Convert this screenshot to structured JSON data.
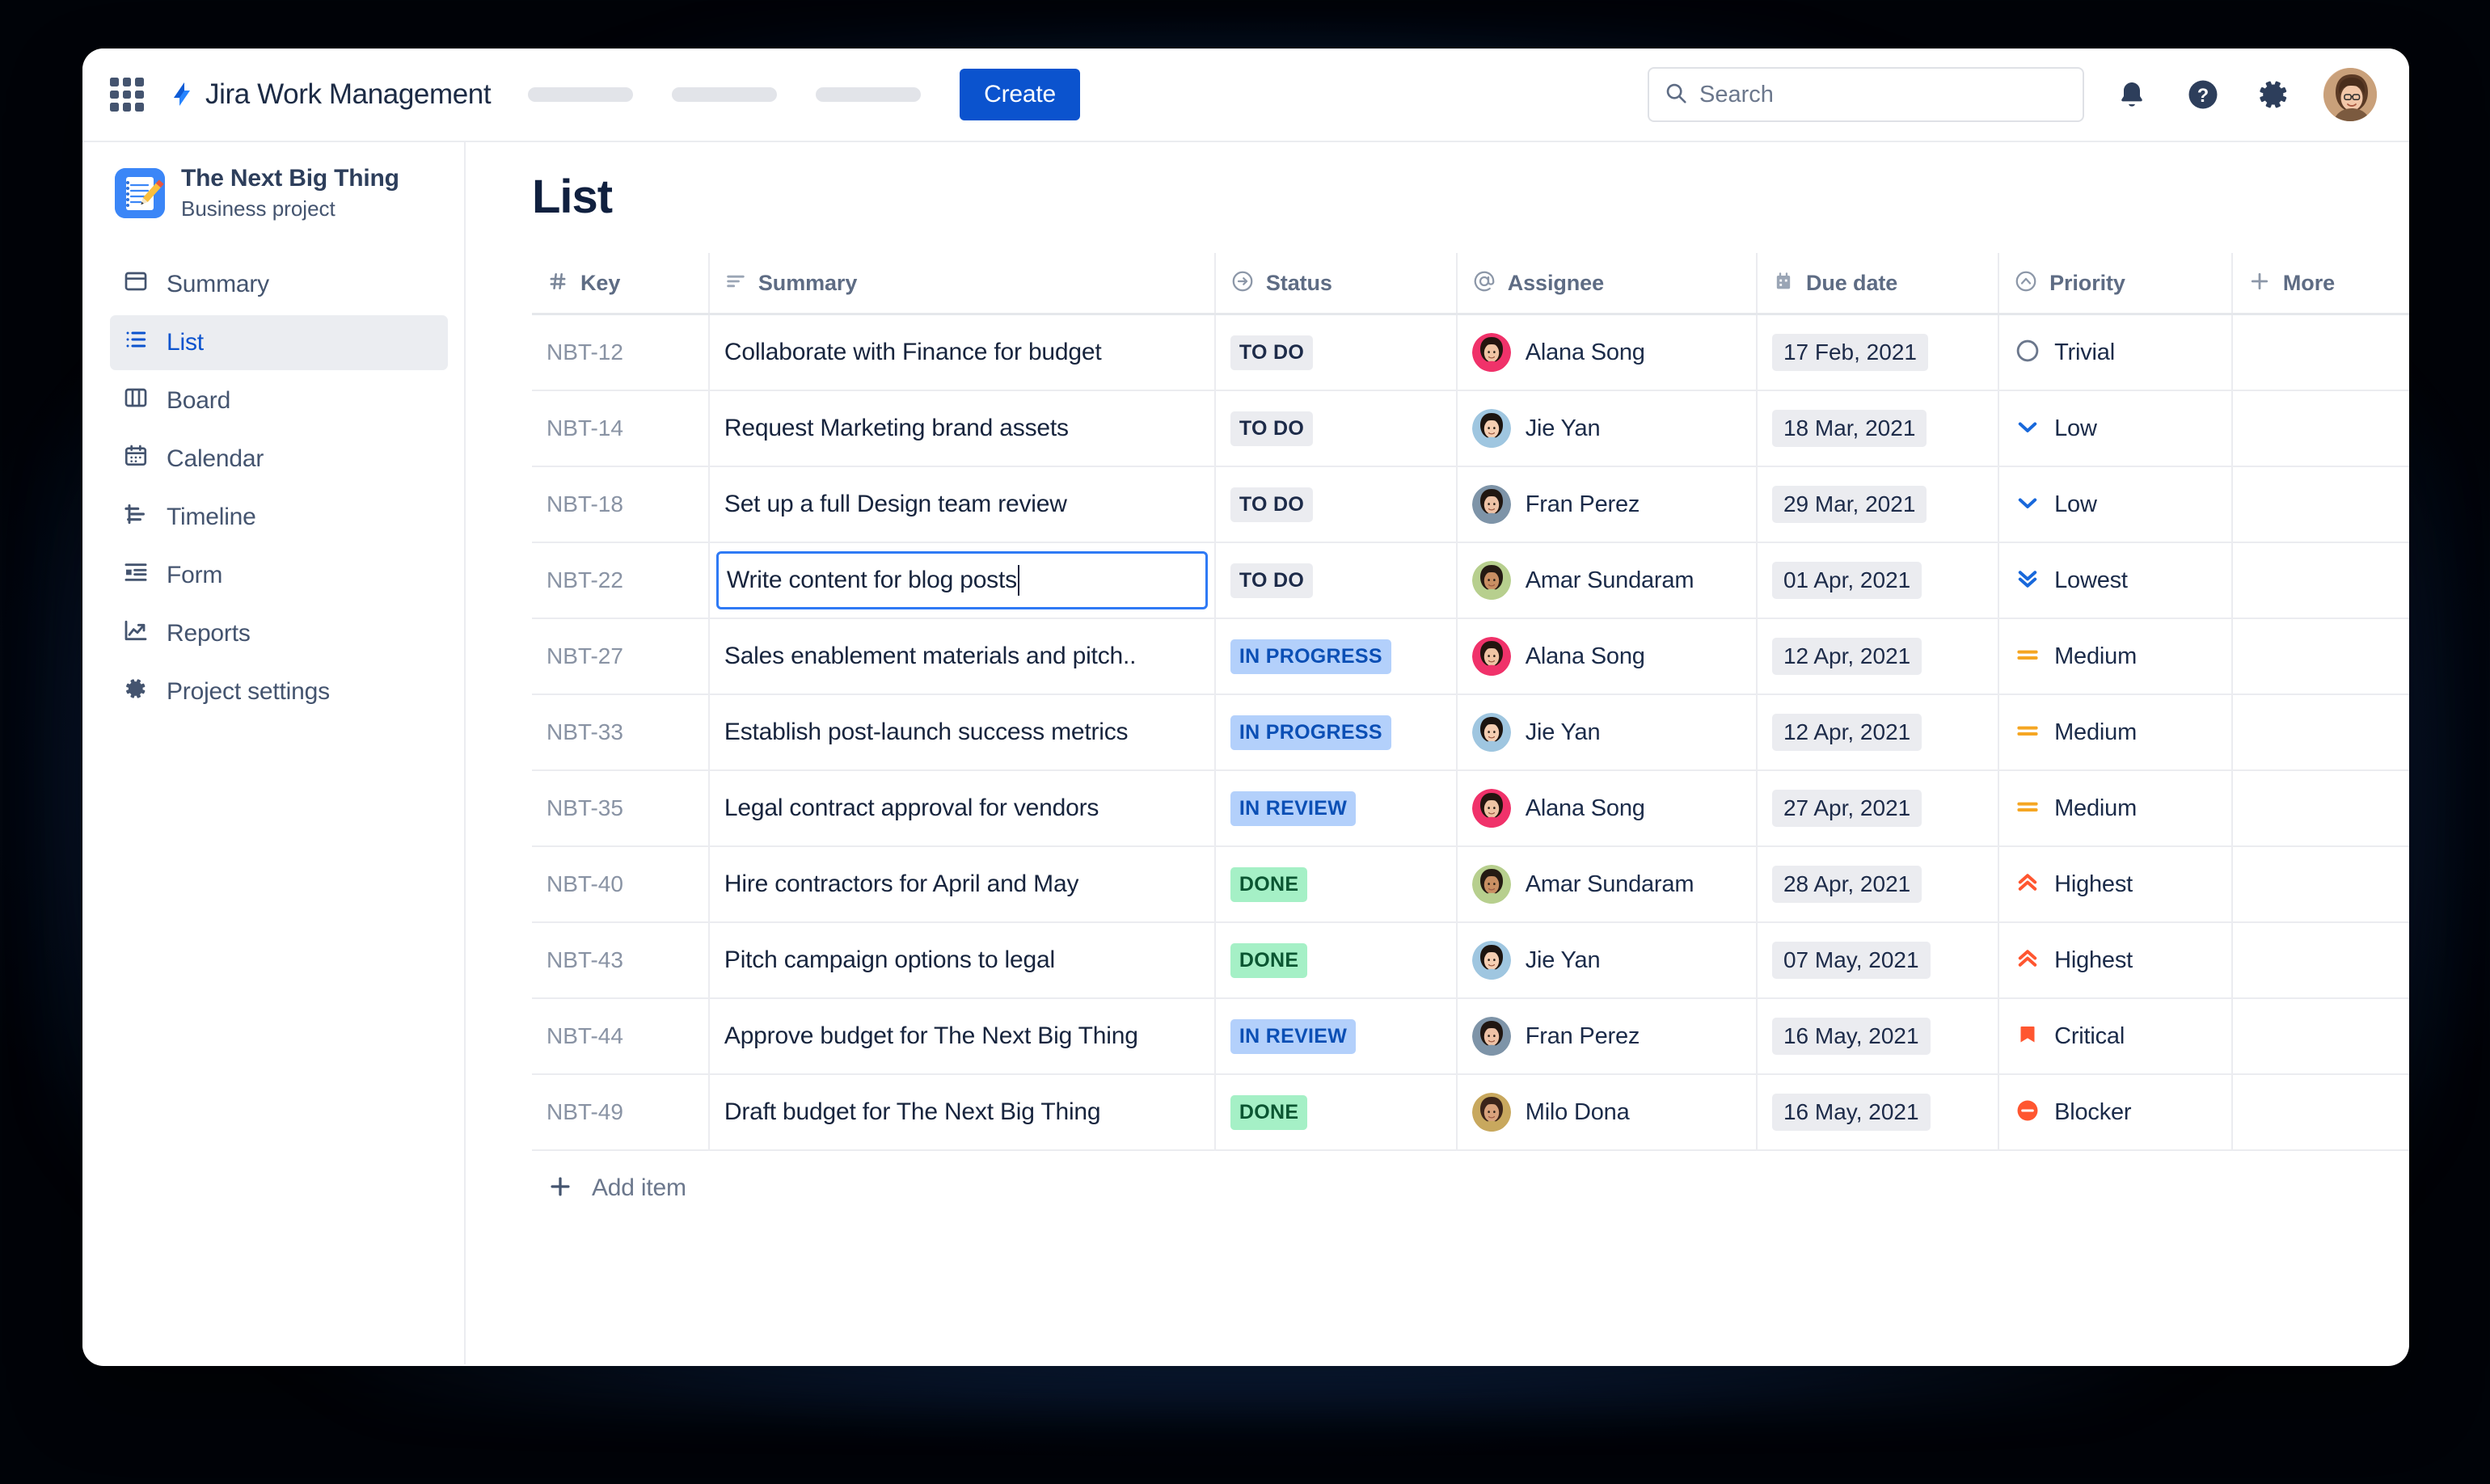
{
  "topbar": {
    "app_name": "Jira Work Management",
    "logo_icon": "jira-logo-icon",
    "app_switcher_icon": "apps-grid-icon",
    "nav_placeholders": [
      "",
      "",
      ""
    ],
    "create_label": "Create",
    "search": {
      "placeholder": "Search",
      "value": "",
      "icon": "search-icon"
    },
    "notifications_icon": "bell-icon",
    "help_icon": "question-circle-icon",
    "settings_icon": "gear-icon",
    "avatar_icon": "user-avatar"
  },
  "sidebar": {
    "project": {
      "name": "The Next Big Thing",
      "type": "Business project",
      "icon": "notepad-pencil-icon"
    },
    "items": [
      {
        "label": "Summary",
        "icon": "summary-window-icon",
        "active": false
      },
      {
        "label": "List",
        "icon": "list-icon",
        "active": true
      },
      {
        "label": "Board",
        "icon": "board-columns-icon",
        "active": false
      },
      {
        "label": "Calendar",
        "icon": "calendar-icon",
        "active": false
      },
      {
        "label": "Timeline",
        "icon": "timeline-icon",
        "active": false
      },
      {
        "label": "Form",
        "icon": "form-icon",
        "active": false
      },
      {
        "label": "Reports",
        "icon": "reports-chart-icon",
        "active": false
      },
      {
        "label": "Project settings",
        "icon": "gear-icon",
        "active": false
      }
    ]
  },
  "main": {
    "page_title": "List",
    "columns": [
      {
        "label": "Key",
        "icon": "hash-icon"
      },
      {
        "label": "Summary",
        "icon": "text-lines-icon"
      },
      {
        "label": "Status",
        "icon": "arrow-right-circle-icon"
      },
      {
        "label": "Assignee",
        "icon": "at-sign-icon"
      },
      {
        "label": "Due date",
        "icon": "calendar-icon"
      },
      {
        "label": "Priority",
        "icon": "chevron-up-circle-icon"
      },
      {
        "label": "More",
        "icon": "plus-icon"
      }
    ],
    "add_item_label": "Add item",
    "add_item_icon": "plus-icon",
    "editing_row_key": "NBT-22",
    "rows": [
      {
        "key": "NBT-12",
        "summary": "Collaborate with Finance for budget",
        "status": "TO DO",
        "status_kind": "todo",
        "assignee": "Alana Song",
        "avatar": "alana",
        "due": "17 Feb, 2021",
        "priority": "Trivial",
        "priority_icon": "circle-outline-icon",
        "editing": false
      },
      {
        "key": "NBT-14",
        "summary": "Request Marketing brand assets",
        "status": "TO DO",
        "status_kind": "todo",
        "assignee": "Jie Yan",
        "avatar": "jie",
        "due": "18 Mar, 2021",
        "priority": "Low",
        "priority_icon": "chevron-down-icon",
        "editing": false
      },
      {
        "key": "NBT-18",
        "summary": "Set up a full Design team review",
        "status": "TO DO",
        "status_kind": "todo",
        "assignee": "Fran Perez",
        "avatar": "fran",
        "due": "29 Mar, 2021",
        "priority": "Low",
        "priority_icon": "chevron-down-icon",
        "editing": false
      },
      {
        "key": "NBT-22",
        "summary": "Write content for blog posts",
        "status": "TO DO",
        "status_kind": "todo",
        "assignee": "Amar Sundaram",
        "avatar": "amar",
        "due": "01 Apr, 2021",
        "priority": "Lowest",
        "priority_icon": "double-chevron-down-icon",
        "editing": true
      },
      {
        "key": "NBT-27",
        "summary": "Sales enablement materials and pitch..",
        "status": "IN PROGRESS",
        "status_kind": "inprogress",
        "assignee": "Alana Song",
        "avatar": "alana",
        "due": "12 Apr, 2021",
        "priority": "Medium",
        "priority_icon": "equals-icon",
        "editing": false
      },
      {
        "key": "NBT-33",
        "summary": "Establish post-launch success metrics",
        "status": "IN PROGRESS",
        "status_kind": "inprogress",
        "assignee": "Jie Yan",
        "avatar": "jie",
        "due": "12 Apr, 2021",
        "priority": "Medium",
        "priority_icon": "equals-icon",
        "editing": false
      },
      {
        "key": "NBT-35",
        "summary": "Legal contract approval for vendors",
        "status": "IN REVIEW",
        "status_kind": "inreview",
        "assignee": "Alana Song",
        "avatar": "alana",
        "due": "27 Apr, 2021",
        "priority": "Medium",
        "priority_icon": "equals-icon",
        "editing": false
      },
      {
        "key": "NBT-40",
        "summary": "Hire contractors for April and May",
        "status": "DONE",
        "status_kind": "done",
        "assignee": "Amar Sundaram",
        "avatar": "amar",
        "due": "28 Apr, 2021",
        "priority": "Highest",
        "priority_icon": "double-chevron-up-icon",
        "editing": false
      },
      {
        "key": "NBT-43",
        "summary": "Pitch campaign options to legal",
        "status": "DONE",
        "status_kind": "done",
        "assignee": "Jie Yan",
        "avatar": "jie",
        "due": "07 May, 2021",
        "priority": "Highest",
        "priority_icon": "double-chevron-up-icon",
        "editing": false
      },
      {
        "key": "NBT-44",
        "summary": "Approve budget for The Next Big Thing",
        "status": "IN REVIEW",
        "status_kind": "inreview",
        "assignee": "Fran Perez",
        "avatar": "fran",
        "due": "16 May, 2021",
        "priority": "Critical",
        "priority_icon": "bookmark-filled-icon",
        "editing": false
      },
      {
        "key": "NBT-49",
        "summary": "Draft budget for The Next Big Thing",
        "status": "DONE",
        "status_kind": "done",
        "assignee": "Milo Dona",
        "avatar": "milo",
        "due": "16 May, 2021",
        "priority": "Blocker",
        "priority_icon": "minus-circle-filled-icon",
        "editing": false
      }
    ]
  },
  "colors": {
    "brand_blue": "#0b53ce",
    "accent_blue": "#2684ff",
    "status_todo_bg": "#ebecf0",
    "status_progress_bg": "#b3d0fb",
    "status_done_bg": "#a5f0c6",
    "priority_low_blue": "#1868db",
    "priority_medium_orange": "#f5a623",
    "priority_high_orange": "#ff5630",
    "text_dark": "#17243d",
    "text_muted": "#6b778c"
  }
}
